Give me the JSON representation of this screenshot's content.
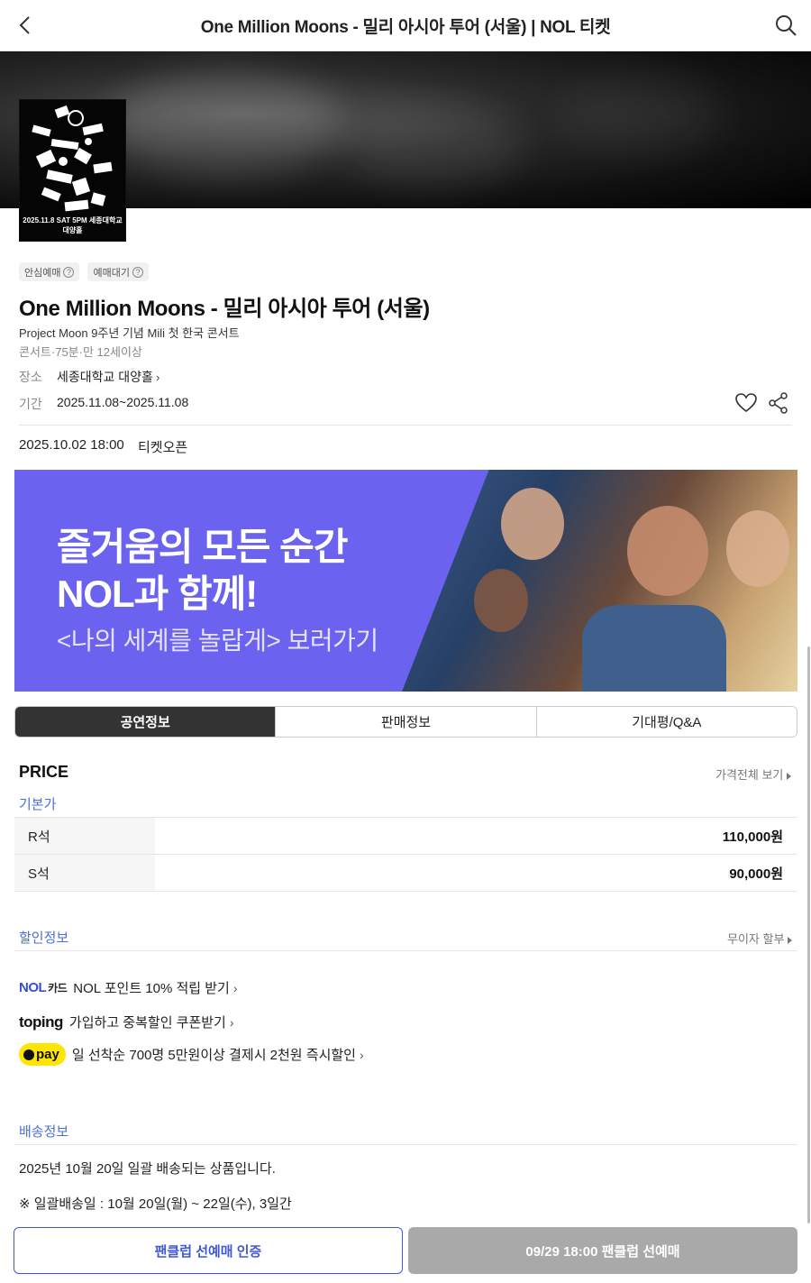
{
  "header": {
    "title": "One Million Moons - 밀리 아시아 투어 (서울) | NOL 티켓"
  },
  "poster": {
    "date_text": "2025.11.8  SAT 5PM  세종대학교 대양홀"
  },
  "badges": [
    "안심예매",
    "예매대기"
  ],
  "performance": {
    "title": "One Million Moons - 밀리 아시아 투어 (서울)",
    "subtitle": "Project Moon 9주년 기념 Mili 첫 한국 콘서트",
    "meta": "콘서트·75분·만 12세이상",
    "venue_label": "장소",
    "venue": "세종대학교 대양홀",
    "period_label": "기간",
    "period": "2025.11.08~2025.11.08",
    "open_date": "2025.10.02 18:00",
    "open_label": "티켓오픈"
  },
  "banner": {
    "line1": "즐거움의 모든 순간",
    "line2": "NOL과 함께!",
    "line3": "<나의 세계를 놀랍게> 보러가기"
  },
  "tabs": [
    "공연정보",
    "판매정보",
    "기대평/Q&A"
  ],
  "price": {
    "title": "PRICE",
    "view_all": "가격전체 보기",
    "base_label": "기본가",
    "rows": [
      {
        "grade": "R석",
        "amount": "110,000원"
      },
      {
        "grade": "S석",
        "amount": "90,000원"
      }
    ]
  },
  "discount": {
    "title": "할인정보",
    "installment": "무이자 할부",
    "items": [
      {
        "brand": "NOL",
        "brand_sub": "카드",
        "text": "NOL 포인트 10% 적립 받기"
      },
      {
        "brand": "toping",
        "text": "가입하고 중복할인 쿠폰받기"
      },
      {
        "brand": "pay",
        "text": "일 선착순 700명 5만원이상 결제시 2천원 즉시할인"
      }
    ]
  },
  "shipping": {
    "title": "배송정보",
    "line1": "2025년 10월 20일 일괄 배송되는 상품입니다.",
    "line2": "※ 일괄배송일 : 10월 20일(월) ~ 22일(수), 3일간"
  },
  "buttons": {
    "cert": "팬클럽 선예매 인증",
    "presale": "09/29 18:00 팬클럽 선예매"
  },
  "colors": {
    "accent": "#4057d8",
    "link_blue": "#4a6fd8",
    "banner_purple": "#6b63f0",
    "disabled": "#a9a9a9"
  }
}
